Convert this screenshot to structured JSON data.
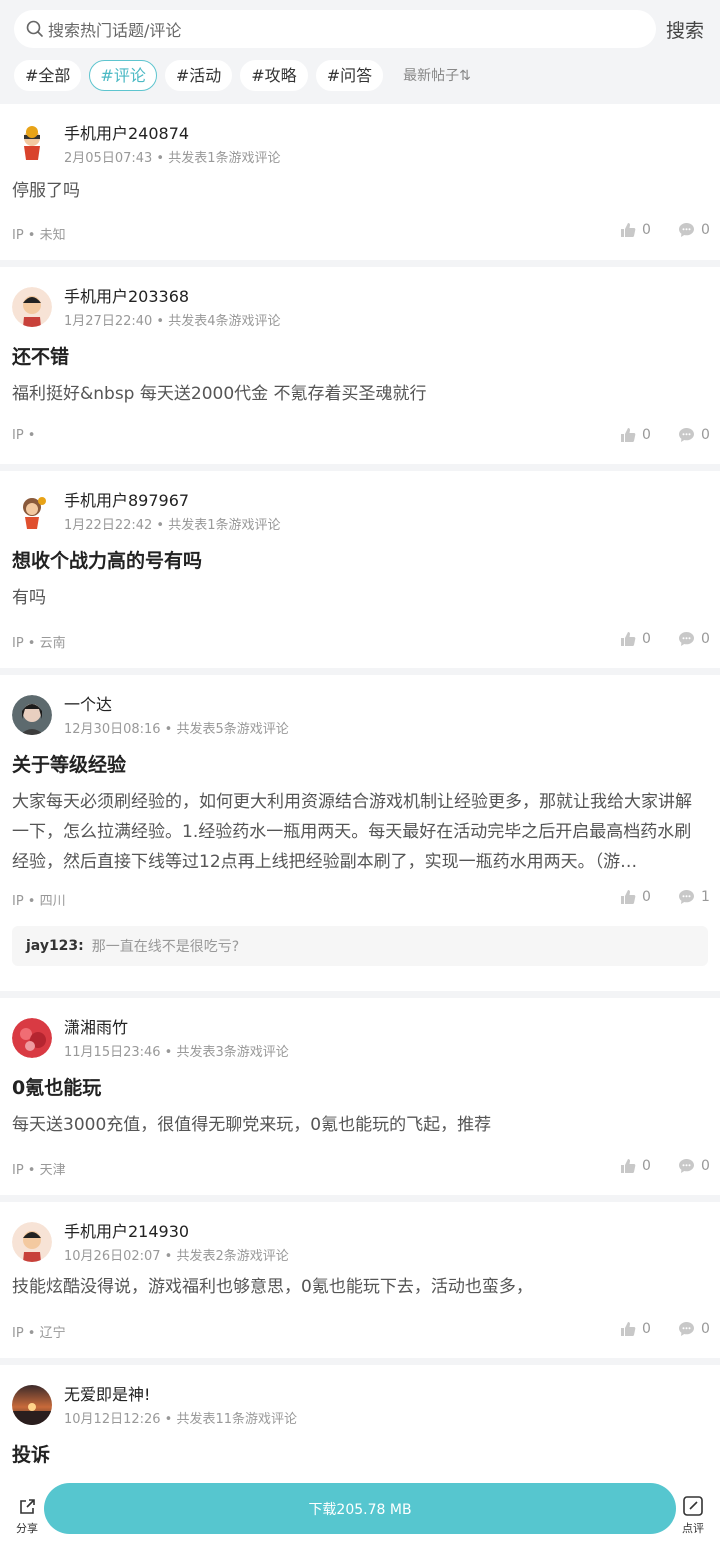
{
  "search": {
    "placeholder": "搜索热门话题/评论",
    "button": "搜索"
  },
  "tags": [
    "#全部",
    "#评论",
    "#活动",
    "#攻略",
    "#问答"
  ],
  "sort_label": "最新帖子⇅",
  "posts": [
    {
      "user": "手机用户240874",
      "meta": "2月05日07:43 • 共发表1条游戏评论",
      "title": "",
      "content": "停服了吗",
      "ip": "IP • 未知",
      "likes": "0",
      "comments": "0"
    },
    {
      "user": "手机用户203368",
      "meta": "1月27日22:40 • 共发表4条游戏评论",
      "title": "还不错",
      "content": "福利挺好&nbsp 每天送2000代金 不氪存着买圣魂就行",
      "ip": "IP •",
      "likes": "0",
      "comments": "0"
    },
    {
      "user": "手机用户897967",
      "meta": "1月22日22:42 • 共发表1条游戏评论",
      "title": "想收个战力高的号有吗",
      "content": "有吗",
      "ip": "IP • 云南",
      "likes": "0",
      "comments": "0"
    },
    {
      "user": "一个达",
      "meta": "12月30日08:16 • 共发表5条游戏评论",
      "title": "关于等级经验",
      "content": "大家每天必须刷经验的，如何更大利用资源结合游戏机制让经验更多，那就让我给大家讲解一下，怎么拉满经验。1.经验药水一瓶用两天。每天最好在活动完毕之后开启最高档药水刷经验，然后直接下线等过12点再上线把经验副本刷了，实现一瓶药水用两天。（游…",
      "ip": "IP • 四川",
      "likes": "0",
      "comments": "1",
      "reply": {
        "user": "jay123:",
        "text": "那一直在线不是很吃亏?"
      }
    },
    {
      "user": "潇湘雨竹",
      "meta": "11月15日23:46 • 共发表3条游戏评论",
      "title": "0氪也能玩",
      "content": "每天送3000充值，很值得无聊党来玩，0氪也能玩的飞起，推荐",
      "ip": "IP • 天津",
      "likes": "0",
      "comments": "0"
    },
    {
      "user": "手机用户214930",
      "meta": "10月26日02:07 • 共发表2条游戏评论",
      "title": "",
      "content": "技能炫酷没得说，游戏福利也够意思，0氪也能玩下去，活动也蛮多，",
      "ip": "IP • 辽宁",
      "likes": "0",
      "comments": "0"
    },
    {
      "user": "无爱即是神!",
      "meta": "10月12日12:26 • 共发表11条游戏评论",
      "title": "投诉",
      "content": "",
      "ip": "",
      "likes": "",
      "comments": ""
    }
  ],
  "bottom": {
    "share": "分享",
    "download": "下载205.78 MB",
    "review": "点评"
  }
}
